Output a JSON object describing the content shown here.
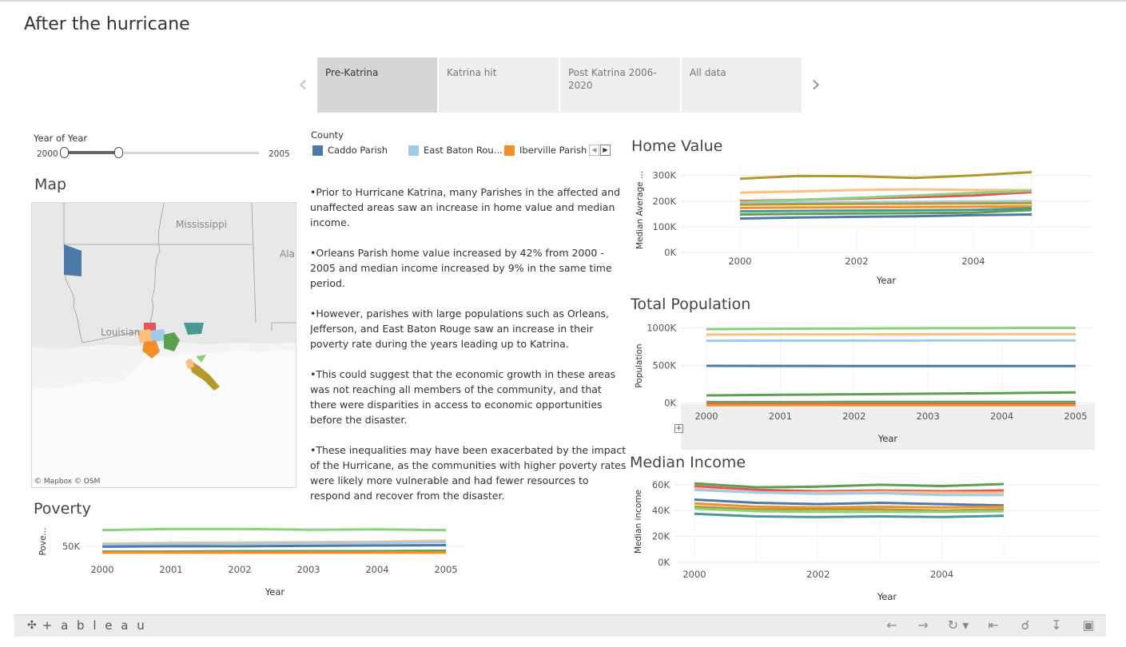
{
  "title": "After the hurricane",
  "story": {
    "prev_icon": "chevron-left-icon",
    "next_icon": "chevron-right-icon",
    "points": [
      {
        "label": "Pre-Katrina",
        "active": true
      },
      {
        "label": "Katrina hit",
        "active": false
      },
      {
        "label": "Post Katrina 2006-2020",
        "active": false
      },
      {
        "label": "All data",
        "active": false
      }
    ]
  },
  "filter": {
    "label": "Year of Year",
    "min_label": "2000",
    "max_label": "2005"
  },
  "map": {
    "title": "Map",
    "labels": {
      "mississippi": "Mississippi",
      "alabama": "Ala",
      "louisiana": "Louisian"
    },
    "attribution": "© Mapbox  © OSM"
  },
  "legend": {
    "title": "County",
    "items": [
      {
        "label": "Caddo Parish",
        "color": "#4e79a7"
      },
      {
        "label": "East Baton Rou...",
        "color": "#a0cbe8"
      },
      {
        "label": "Iberville Parish",
        "color": "#f28e2b"
      }
    ]
  },
  "text": {
    "p1": "•Prior to Hurricane Katrina, many Parishes in the affected and unaffected areas saw an increase in home value and median income.",
    "p2": "•Orleans Parish home value increased by 42% from 2000 - 2005 and median income increased by 9% in the same time period.",
    "p3": "•However, parishes with large populations such as Orleans, Jefferson, and East Baton Rouge saw an increase in their poverty rate during the years leading up to Katrina.",
    "p4": "•This could suggest that the economic growth in these areas was not reaching all members of the community, and that there were disparities in access to economic opportunities before the disaster.",
    "p5": "•These inequalities may have been exacerbated by the impact of the Hurricane, as the communities with higher poverty rates were likely more vulnerable and had fewer resources to respond and recover from the disaster."
  },
  "chart_data": [
    {
      "id": "home_value",
      "type": "line",
      "title": "Home Value",
      "xlabel": "Year",
      "ylabel": "Median Average ...",
      "x": [
        2000,
        2001,
        2002,
        2003,
        2004,
        2005
      ],
      "x_ticks": [
        "2000",
        "2002",
        "2004"
      ],
      "x_tick_values": [
        2000,
        2002,
        2004
      ],
      "y_ticks": [
        "300K",
        "200K",
        "100K",
        "0K"
      ],
      "y_tick_values": [
        300000,
        200000,
        100000,
        0
      ],
      "ylim": [
        0,
        330000
      ],
      "grid": true,
      "series": [
        {
          "color": "#b0982c",
          "values": [
            287000,
            298000,
            297000,
            290000,
            300000,
            313000
          ]
        },
        {
          "color": "#ffbe7d",
          "values": [
            233000,
            238000,
            243000,
            246000,
            243000,
            243000
          ]
        },
        {
          "color": "#e15759",
          "values": [
            200000,
            205000,
            210000,
            215000,
            222000,
            235000
          ]
        },
        {
          "color": "#8cd17d",
          "values": [
            196000,
            205000,
            213000,
            222000,
            232000,
            240000
          ]
        },
        {
          "color": "#a0cbe8",
          "values": [
            192000,
            194000,
            196000,
            197000,
            199000,
            200000
          ]
        },
        {
          "color": "#b6992d",
          "values": [
            186000,
            188000,
            189000,
            190000,
            191000,
            192000
          ]
        },
        {
          "color": "#f28e2b",
          "values": [
            173000,
            175000,
            176000,
            177000,
            178000,
            180000
          ]
        },
        {
          "color": "#499894",
          "values": [
            160000,
            162000,
            163000,
            164000,
            166000,
            172000
          ]
        },
        {
          "color": "#59a14f",
          "values": [
            148000,
            150000,
            152000,
            153000,
            155000,
            165000
          ]
        },
        {
          "color": "#4e79a7",
          "values": [
            132000,
            136000,
            139000,
            141000,
            145000,
            148000
          ]
        }
      ]
    },
    {
      "id": "total_population",
      "type": "line",
      "title": "Total Population",
      "xlabel": "Year",
      "ylabel": "Population",
      "x": [
        2000,
        2001,
        2002,
        2003,
        2004,
        2005
      ],
      "x_ticks": [
        "2000",
        "2001",
        "2002",
        "2003",
        "2004",
        "2005"
      ],
      "x_tick_values": [
        2000,
        2001,
        2002,
        2003,
        2004,
        2005
      ],
      "y_ticks": [
        "1000K",
        "500K",
        "0K"
      ],
      "y_tick_values": [
        1000000,
        500000,
        0
      ],
      "ylim": [
        -60000,
        1050000
      ],
      "grid": true,
      "series": [
        {
          "color": "#8cd17d",
          "values": [
            985000,
            990000,
            995000,
            998000,
            1000000,
            1002000
          ]
        },
        {
          "color": "#ffbe7d",
          "values": [
            912000,
            915000,
            916000,
            917000,
            918000,
            918000
          ]
        },
        {
          "color": "#a0cbe8",
          "values": [
            830000,
            832000,
            832000,
            833000,
            833000,
            834000
          ]
        },
        {
          "color": "#4e79a7",
          "values": [
            495000,
            494000,
            493000,
            492000,
            492000,
            492000
          ]
        },
        {
          "color": "#59a14f",
          "values": [
            100000,
            108000,
            115000,
            122000,
            130000,
            140000
          ]
        },
        {
          "color": "#499894",
          "values": [
            10000,
            10000,
            11000,
            11000,
            12000,
            12000
          ]
        },
        {
          "color": "#b6992d",
          "values": [
            -5000,
            -5000,
            -5000,
            -4000,
            -4000,
            -4000
          ]
        },
        {
          "color": "#e15759",
          "values": [
            -18000,
            -18000,
            -17000,
            -17000,
            -17000,
            -17000
          ]
        },
        {
          "color": "#f28e2b",
          "values": [
            -30000,
            -30000,
            -30000,
            -30000,
            -30000,
            -30000
          ]
        }
      ]
    },
    {
      "id": "median_income",
      "type": "line",
      "title": "Median Income",
      "xlabel": "Year",
      "ylabel": "Median income",
      "x": [
        2000,
        2001,
        2002,
        2003,
        2004,
        2005
      ],
      "x_ticks": [
        "2000",
        "2002",
        "2004"
      ],
      "x_tick_values": [
        2000,
        2002,
        2004
      ],
      "y_ticks": [
        "60K",
        "40K",
        "20K",
        "0K"
      ],
      "y_tick_values": [
        60000,
        40000,
        20000,
        0
      ],
      "ylim": [
        0,
        63000
      ],
      "grid": true,
      "series": [
        {
          "color": "#59a14f",
          "values": [
            61000,
            58000,
            58500,
            60000,
            59000,
            60500
          ]
        },
        {
          "color": "#e15759",
          "values": [
            59000,
            56000,
            55000,
            55500,
            55000,
            55500
          ]
        },
        {
          "color": "#ffbe7d",
          "values": [
            57000,
            54000,
            54000,
            54500,
            54000,
            54000
          ]
        },
        {
          "color": "#a0cbe8",
          "values": [
            56000,
            54000,
            53000,
            53500,
            52000,
            52000
          ]
        },
        {
          "color": "#4e79a7",
          "values": [
            48500,
            46000,
            45000,
            46000,
            45000,
            44000
          ]
        },
        {
          "color": "#f28e2b",
          "values": [
            45500,
            43000,
            42500,
            43000,
            42500,
            43000
          ]
        },
        {
          "color": "#b6992d",
          "values": [
            43000,
            41000,
            41000,
            41000,
            40000,
            41000
          ]
        },
        {
          "color": "#8cd17d",
          "values": [
            41500,
            39500,
            39000,
            39000,
            39000,
            39500
          ]
        },
        {
          "color": "#499894",
          "values": [
            37500,
            35500,
            35000,
            35500,
            35000,
            36000
          ]
        }
      ]
    },
    {
      "id": "poverty",
      "type": "line",
      "title": "Poverty",
      "xlabel": "Year",
      "ylabel": "Pove...",
      "x": [
        2000,
        2001,
        2002,
        2003,
        2004,
        2005
      ],
      "x_ticks": [
        "2000",
        "2001",
        "2002",
        "2003",
        "2004",
        "2005"
      ],
      "x_tick_values": [
        2000,
        2001,
        2002,
        2003,
        2004,
        2005
      ],
      "y_ticks": [
        "50K"
      ],
      "y_tick_values": [
        50000
      ],
      "ylim": [
        20000,
        105000
      ],
      "grid": true,
      "series": [
        {
          "color": "#8cd17d",
          "values": [
            93000,
            96000,
            96000,
            94000,
            95000,
            93000
          ]
        },
        {
          "color": "#ffbe7d",
          "values": [
            57000,
            59000,
            60000,
            61000,
            62000,
            65000
          ]
        },
        {
          "color": "#a0cbe8",
          "values": [
            54000,
            56000,
            57000,
            58000,
            59000,
            61000
          ]
        },
        {
          "color": "#4e79a7",
          "values": [
            49000,
            50000,
            50000,
            51000,
            52000,
            53000
          ]
        },
        {
          "color": "#59a14f",
          "values": [
            36000,
            36000,
            37000,
            37000,
            37000,
            38000
          ]
        },
        {
          "color": "#b6992d",
          "values": [
            34000,
            34000,
            34000,
            34000,
            34000,
            34000
          ]
        },
        {
          "color": "#f28e2b",
          "values": [
            33000,
            33000,
            33000,
            33000,
            33000,
            33000
          ]
        }
      ]
    }
  ],
  "toolbar": {
    "logo_icon": "tableau-logo-icon",
    "logo_text": "+ a b l e a u",
    "undo_icon": "undo-icon",
    "redo_icon": "redo-icon",
    "revert_icon": "revert-icon",
    "pause_icon": "revert-start-icon",
    "share_icon": "share-icon",
    "download_icon": "download-icon",
    "fullscreen_icon": "fullscreen-icon"
  }
}
